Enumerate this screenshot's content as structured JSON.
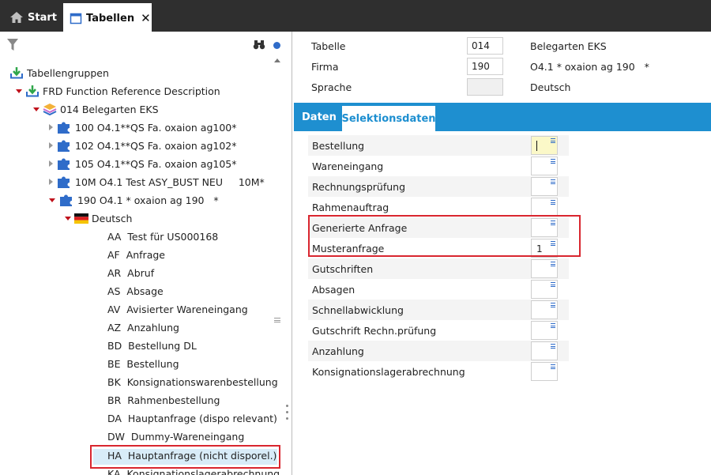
{
  "tabs": {
    "start": "Start",
    "tabellen": "Tabellen"
  },
  "tree": {
    "root": "Tabellengruppen",
    "frd": "FRD  Function Reference Description",
    "table014": "014  Belegarten EKS",
    "companies": [
      "100 O4.1**QS Fa. oxaion ag100*",
      "102 O4.1**QS Fa. oxaion ag102*",
      "105 O4.1**QS Fa. oxaion ag105*",
      "10M O4.1 Test ASY_BUST NEU     10M*",
      "190 O4.1 * oxaion ag 190   *"
    ],
    "language": "Deutsch",
    "items": [
      "AA  Test für US000168",
      "AF  Anfrage",
      "AR  Abruf",
      "AS  Absage",
      "AV  Avisierter Wareneingang",
      "AZ  Anzahlung",
      "BD  Bestellung DL",
      "BE  Bestellung",
      "BK  Konsignationswarenbestellung",
      "BR  Rahmenbestellung",
      "DA  Hauptanfrage (dispo relevant)",
      "DW  Dummy-Wareneingang",
      "HA  Hauptanfrage (nicht disporel.)",
      "KA  Konsignationslagerabrechnung"
    ]
  },
  "header": {
    "tabelle_label": "Tabelle",
    "tabelle_value": "014",
    "tabelle_desc": "Belegarten EKS",
    "firma_label": "Firma",
    "firma_value": "190",
    "firma_desc": "O4.1 * oxaion ag 190   *",
    "sprache_label": "Sprache",
    "sprache_value": "",
    "sprache_desc": "Deutsch"
  },
  "detail_tabs": {
    "daten": "Daten",
    "selektionsdaten": "Selektionsdaten"
  },
  "fields": [
    {
      "label": "Bestellung",
      "value": ""
    },
    {
      "label": "Wareneingang",
      "value": ""
    },
    {
      "label": "Rechnungsprüfung",
      "value": ""
    },
    {
      "label": "Rahmenauftrag",
      "value": ""
    },
    {
      "label": "Generierte Anfrage",
      "value": ""
    },
    {
      "label": "Musteranfrage",
      "value": "1"
    },
    {
      "label": "Gutschriften",
      "value": ""
    },
    {
      "label": "Absagen",
      "value": ""
    },
    {
      "label": "Schnellabwicklung",
      "value": ""
    },
    {
      "label": "Gutschrift Rechn.prüfung",
      "value": ""
    },
    {
      "label": "Anzahlung",
      "value": ""
    },
    {
      "label": "Konsignationslagerabrechnung",
      "value": ""
    }
  ],
  "colors": {
    "accent": "#1e8fd0",
    "highlight": "#d9262f",
    "selected": "#d8ecf8"
  }
}
